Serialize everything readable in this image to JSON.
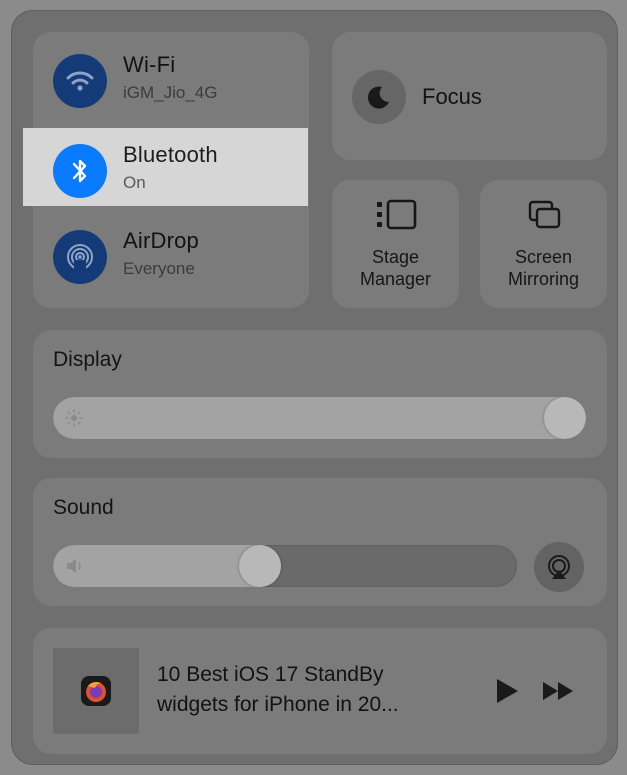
{
  "network": {
    "wifi": {
      "title": "Wi-Fi",
      "subtitle": "iGM_Jio_4G"
    },
    "bluetooth": {
      "title": "Bluetooth",
      "subtitle": "On"
    },
    "airdrop": {
      "title": "AirDrop",
      "subtitle": "Everyone"
    }
  },
  "focus": {
    "label": "Focus"
  },
  "stage_manager": {
    "label_line1": "Stage",
    "label_line2": "Manager"
  },
  "screen_mirroring": {
    "label_line1": "Screen",
    "label_line2": "Mirroring"
  },
  "display": {
    "title": "Display",
    "brightness_fraction": 1.0
  },
  "sound": {
    "title": "Sound",
    "volume_fraction": 0.44
  },
  "now_playing": {
    "title_line1": "10 Best iOS 17 StandBy",
    "title_line2": "widgets for iPhone in 20..."
  },
  "icons": {
    "wifi": "wifi-icon",
    "bluetooth": "bluetooth-icon",
    "airdrop": "airdrop-icon",
    "focus": "moon-icon",
    "stage_manager": "stage-manager-icon",
    "screen_mirroring": "screen-mirroring-icon",
    "brightness": "sun-icon",
    "volume": "speaker-icon",
    "airplay": "airplay-audio-icon",
    "app": "firefox-icon",
    "play": "play-icon",
    "next": "fast-forward-icon"
  },
  "colors": {
    "bluetooth_active": "#0a7bff",
    "inactive_circle": "#143b78",
    "highlight": "#d6d6d6"
  }
}
